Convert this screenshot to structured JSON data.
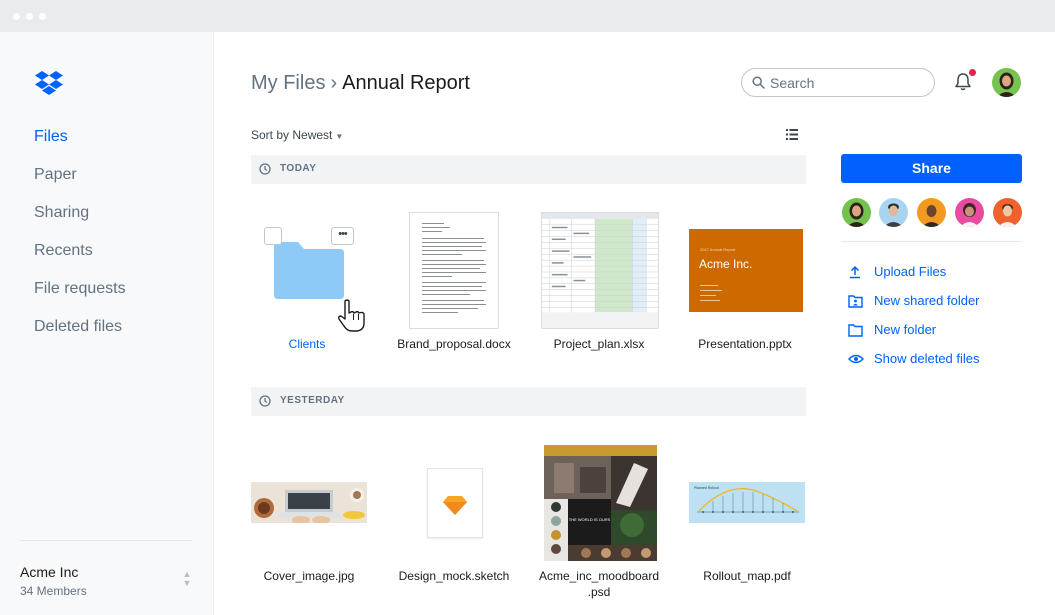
{
  "window": {
    "controls": [
      "close",
      "minimize",
      "maximize"
    ]
  },
  "sidebar": {
    "items": [
      {
        "label": "Files",
        "active": true
      },
      {
        "label": "Paper"
      },
      {
        "label": "Sharing"
      },
      {
        "label": "Recents"
      },
      {
        "label": "File requests"
      },
      {
        "label": "Deleted files"
      }
    ],
    "team": {
      "name": "Acme Inc",
      "members": "34 Members"
    }
  },
  "header": {
    "breadcrumb_root": "My Files",
    "breadcrumb_separator": "›",
    "breadcrumb_current": "Annual Report",
    "search_placeholder": "Search",
    "notification_unread": true
  },
  "toolbar": {
    "sort_label": "Sort by Newest"
  },
  "sections": [
    {
      "label": "TODAY",
      "files": [
        {
          "name": "Clients",
          "type": "folder"
        },
        {
          "name": "Brand_proposal.docx",
          "type": "docx"
        },
        {
          "name": "Project_plan.xlsx",
          "type": "xlsx"
        },
        {
          "name": "Presentation.pptx",
          "type": "pptx",
          "thumb_small": "2017 Annual Report",
          "thumb_title": "Acme Inc."
        }
      ]
    },
    {
      "label": "YESTERDAY",
      "files": [
        {
          "name": "Cover_image.jpg",
          "type": "jpg"
        },
        {
          "name": "Design_mock.sketch",
          "type": "sketch"
        },
        {
          "name": "Acme_inc_moodboard\n.psd",
          "type": "psd",
          "thumb_text": "THE WORLD IS OURS"
        },
        {
          "name": "Rollout_map.pdf",
          "type": "pdf",
          "thumb_title": "Planned Rollout"
        }
      ]
    }
  ],
  "right_panel": {
    "share_label": "Share",
    "actions": [
      {
        "label": "Upload Files",
        "icon": "upload-icon"
      },
      {
        "label": "New shared folder",
        "icon": "shared-folder-icon"
      },
      {
        "label": "New folder",
        "icon": "folder-icon"
      },
      {
        "label": "Show deleted files",
        "icon": "eye-icon"
      }
    ]
  },
  "colors": {
    "accent": "#0061fe",
    "folder": "#8ecaf8",
    "presentation": "#cc6a00",
    "notification": "#e0244a"
  }
}
